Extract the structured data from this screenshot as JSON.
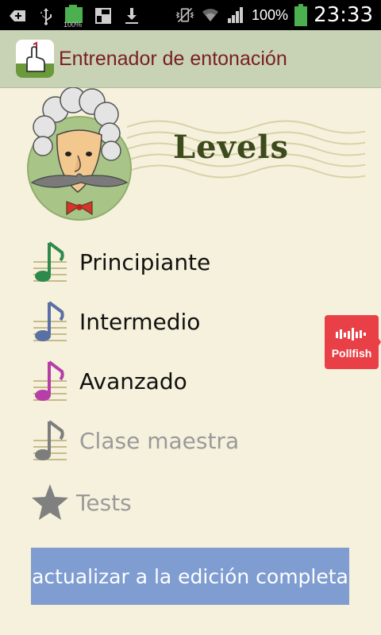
{
  "status_bar": {
    "battery_small": "100%",
    "battery_percent": "100%",
    "time": "23:33",
    "icons": [
      "add-icon",
      "usb-icon",
      "battery-small-icon",
      "app-notification-icon",
      "download-icon",
      "vibrate-icon",
      "wifi-icon",
      "signal-icon",
      "battery-icon"
    ]
  },
  "action_bar": {
    "title": "Entrenador de entonación",
    "icon": "app-logo-icon"
  },
  "header": {
    "title": "Levels",
    "mascot": "mascot-image"
  },
  "levels": [
    {
      "label": "Principiante",
      "note_color": "#2e8a4c",
      "enabled": true
    },
    {
      "label": "Intermedio",
      "note_color": "#5a6fa3",
      "enabled": true
    },
    {
      "label": "Avanzado",
      "note_color": "#b53fa6",
      "enabled": true
    },
    {
      "label": "Clase maestra",
      "note_color": "#7d7d7d",
      "enabled": false
    }
  ],
  "tests": {
    "label": "Tests",
    "icon": "star-icon",
    "enabled": false
  },
  "upgrade_button": {
    "label": "actualizar a la edición completa"
  },
  "pollfish": {
    "label": "Pollfish",
    "color": "#e84046"
  }
}
